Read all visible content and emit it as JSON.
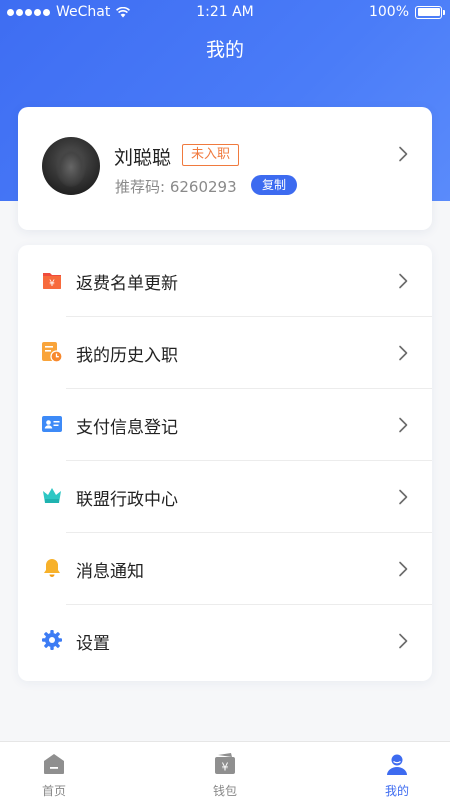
{
  "status_bar": {
    "carrier": "WeChat",
    "time": "1:21 AM",
    "battery": "100%"
  },
  "header": {
    "title": "我的"
  },
  "profile": {
    "name": "刘聪聪",
    "status_badge": "未入职",
    "referral_label": "推荐码: 6260293",
    "copy_label": "复制"
  },
  "menu": {
    "items": [
      {
        "label": "返费名单更新",
        "icon": "rebate-list-icon"
      },
      {
        "label": "我的历史入职",
        "icon": "history-clock-icon"
      },
      {
        "label": "支付信息登记",
        "icon": "id-card-icon"
      },
      {
        "label": "联盟行政中心",
        "icon": "crown-icon"
      },
      {
        "label": "消息通知",
        "icon": "bell-icon"
      },
      {
        "label": "设置",
        "icon": "gear-icon"
      }
    ]
  },
  "tabbar": {
    "items": [
      {
        "label": "首页",
        "icon": "home-icon",
        "active": false
      },
      {
        "label": "钱包",
        "icon": "wallet-icon",
        "active": false
      },
      {
        "label": "我的",
        "icon": "user-icon",
        "active": true
      }
    ]
  },
  "colors": {
    "accent": "#3d6bf0",
    "badge_orange": "#f07a3e"
  }
}
